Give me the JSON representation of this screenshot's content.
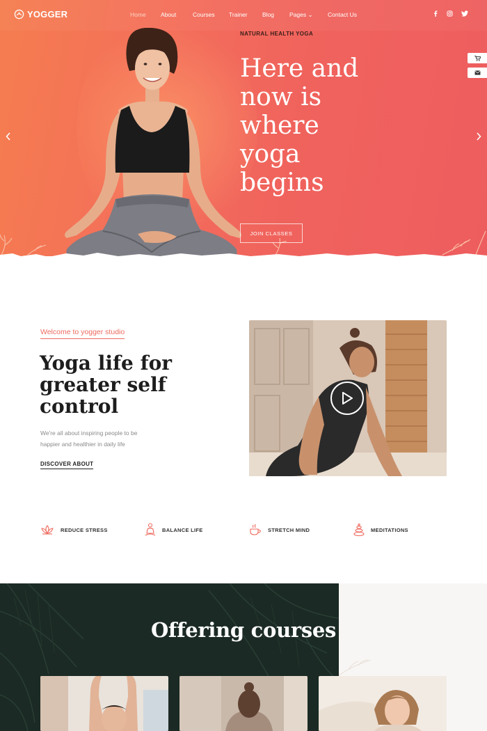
{
  "brand": {
    "name": "YOGGER"
  },
  "nav": {
    "items": [
      {
        "label": "Home",
        "active": true
      },
      {
        "label": "About"
      },
      {
        "label": "Courses"
      },
      {
        "label": "Trainer"
      },
      {
        "label": "Blog"
      },
      {
        "label": "Pages ⌄"
      },
      {
        "label": "Contact Us"
      }
    ]
  },
  "social": [
    "facebook-icon",
    "instagram-icon",
    "twitter-icon"
  ],
  "hero": {
    "eyebrow": "NATURAL HEALTH YOGA",
    "headline": "Here and now is where yoga begins",
    "cta": "JOIN CLASSES",
    "colors": {
      "start": "#f57d4f",
      "end": "#ee5d5e"
    }
  },
  "welcome": {
    "tag": "Welcome to yogger studio",
    "title": "Yoga life for greater self control",
    "text": "We're all about inspiring people to be happier and healthier in daily life",
    "link": "DISCOVER ABOUT"
  },
  "features": [
    {
      "label": "REDUCE STRESS",
      "icon": "lotus-icon"
    },
    {
      "label": "BALANCE LIFE",
      "icon": "meditation-icon"
    },
    {
      "label": "STRETCH MIND",
      "icon": "tea-cup-icon"
    },
    {
      "label": "MEDITATIONS",
      "icon": "stones-icon"
    }
  ],
  "courses": {
    "title": "Offering courses"
  },
  "accent": "#ee6a5e"
}
